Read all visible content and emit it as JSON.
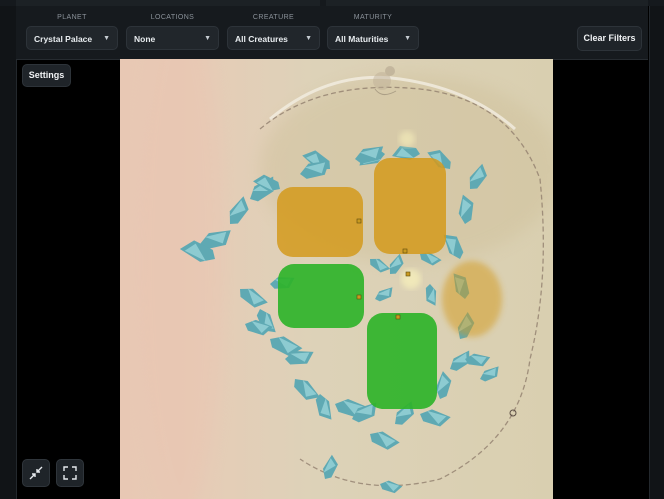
{
  "filters": [
    {
      "label": "PLANET",
      "value": "Crystal Palace"
    },
    {
      "label": "LOCATIONS",
      "value": "None"
    },
    {
      "label": "CREATURE",
      "value": "All Creatures"
    },
    {
      "label": "MATURITY",
      "value": "All Maturities"
    }
  ],
  "clear_filters_label": "Clear Filters",
  "settings_label": "Settings",
  "zones": [
    {
      "category": "orange",
      "color": "#d39a1c"
    },
    {
      "category": "orange",
      "color": "#d39a1c"
    },
    {
      "category": "green",
      "color": "#2fb32a"
    },
    {
      "category": "green",
      "color": "#2fb32a"
    },
    {
      "category": "orange-faint",
      "color": "#d39a1c"
    }
  ],
  "icons": {
    "collapse": "collapse-arrows-icon",
    "fullscreen": "fullscreen-icon",
    "caret": "▼"
  },
  "colors": {
    "background": "#000000",
    "toolbar": "#161a1e",
    "orange_zone": "#d39a1c",
    "green_zone": "#2fb32a",
    "crystal": "#5fa9b3"
  }
}
